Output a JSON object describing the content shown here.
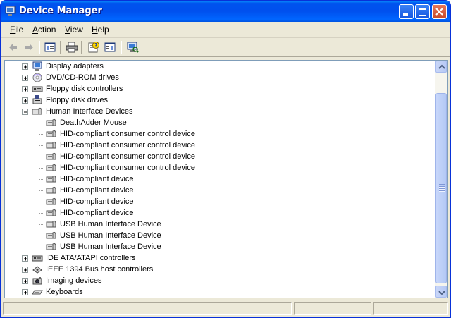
{
  "window": {
    "title": "Device Manager",
    "icon": "computer-monitor-icon",
    "controls": [
      "minimize-icon",
      "maximize-icon",
      "close-icon"
    ]
  },
  "menu": {
    "items": [
      {
        "label": "File",
        "hotkey_index": 0
      },
      {
        "label": "Action",
        "hotkey_index": 0
      },
      {
        "label": "View",
        "hotkey_index": 0
      },
      {
        "label": "Help",
        "hotkey_index": 0
      }
    ]
  },
  "toolbar": {
    "buttons": [
      "back-arrow-icon",
      "forward-arrow-icon",
      "show-hide-tree-icon",
      "print-icon",
      "properties-help-icon",
      "console-tree-icon",
      "scan-hardware-icon"
    ]
  },
  "tree": {
    "rows": [
      {
        "label": "Display adapters",
        "icon": "display-adapter-icon",
        "level": 0,
        "expander": "plus"
      },
      {
        "label": "DVD/CD-ROM drives",
        "icon": "cd-drive-icon",
        "level": 0,
        "expander": "plus"
      },
      {
        "label": "Floppy disk controllers",
        "icon": "disk-controller-icon",
        "level": 0,
        "expander": "plus"
      },
      {
        "label": "Floppy disk drives",
        "icon": "floppy-drive-icon",
        "level": 0,
        "expander": "plus"
      },
      {
        "label": "Human Interface Devices",
        "icon": "hid-icon",
        "level": 0,
        "expander": "minus"
      },
      {
        "label": "DeathAdder Mouse",
        "icon": "hid-device-icon",
        "level": 1,
        "expander": "none"
      },
      {
        "label": "HID-compliant consumer control device",
        "icon": "hid-device-icon",
        "level": 1,
        "expander": "none"
      },
      {
        "label": "HID-compliant consumer control device",
        "icon": "hid-device-icon",
        "level": 1,
        "expander": "none"
      },
      {
        "label": "HID-compliant consumer control device",
        "icon": "hid-device-icon",
        "level": 1,
        "expander": "none"
      },
      {
        "label": "HID-compliant consumer control device",
        "icon": "hid-device-icon",
        "level": 1,
        "expander": "none"
      },
      {
        "label": "HID-compliant device",
        "icon": "hid-device-icon",
        "level": 1,
        "expander": "none"
      },
      {
        "label": "HID-compliant device",
        "icon": "hid-device-icon",
        "level": 1,
        "expander": "none"
      },
      {
        "label": "HID-compliant device",
        "icon": "hid-device-icon",
        "level": 1,
        "expander": "none"
      },
      {
        "label": "HID-compliant device",
        "icon": "hid-device-icon",
        "level": 1,
        "expander": "none"
      },
      {
        "label": "USB Human Interface Device",
        "icon": "hid-device-icon",
        "level": 1,
        "expander": "none"
      },
      {
        "label": "USB Human Interface Device",
        "icon": "hid-device-icon",
        "level": 1,
        "expander": "none"
      },
      {
        "label": "USB Human Interface Device",
        "icon": "hid-device-icon",
        "level": 1,
        "expander": "none"
      },
      {
        "label": "IDE ATA/ATAPI controllers",
        "icon": "ide-controller-icon",
        "level": 0,
        "expander": "plus"
      },
      {
        "label": "IEEE 1394 Bus host controllers",
        "icon": "ieee1394-icon",
        "level": 0,
        "expander": "plus"
      },
      {
        "label": "Imaging devices",
        "icon": "imaging-device-icon",
        "level": 0,
        "expander": "plus"
      },
      {
        "label": "Keyboards",
        "icon": "keyboard-icon",
        "level": 0,
        "expander": "plus"
      }
    ]
  },
  "colors": {
    "titlebar": "#0054e3",
    "window_face": "#ece9d8",
    "tree_border": "#7f9db9",
    "scrollbar": "#b6c9f6"
  }
}
